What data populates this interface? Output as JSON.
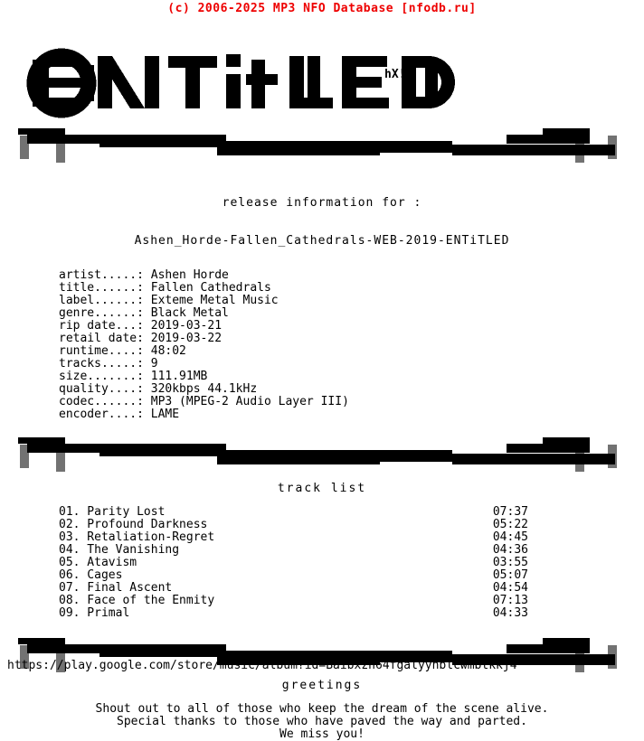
{
  "banner": {
    "copyright": "(c) 2006-2025 MP3 NFO Database [nfodb.ru]",
    "color": "#ee0000"
  },
  "logo": {
    "group_name": "ENTiTLED",
    "artist_signature": "hX!",
    "ascii_art": "  ▄█████▄  ▄██▄  ▄██▄ █████▄ ▄██▄ ███████▄ ▄██▄      ▄████▄  ▄██████▄\n ███▀▀▀███ ████▄ ███▀  ▀██▀  ▀▀███▀▀  ███▀▀     ▀██▀     ███▀▀███ ███▀▀▀███\n ███████▀  ███ ▀████     ██    ███    ███▄▄▄     ██      ███▄▄███ ███   ███\n ███▄▄▄▄▄  ███   ▀███    ██    ███    ███▀▀▀     ██      ███▀▀███ ███▄▄▄███\n  ▀█████▀  ▀██▄   ▀██▀  ▄██▄   ███    ███████▄ ▄████▄▄▄  ███  ███ ▀███████▀",
    "signature_position": "center-right"
  },
  "dividers": {
    "ascii_art": "▄▄▄▄▄                                                                  ▄▄▄▄\n░░░▒▒▓█████▓▓▒░░▄▄▄▄▄▄▄▄▄▄▄▄▄▄▄▒▒░░▄▄▄▄▄▄▄▄▄▄▄▄▄▄▄▄▄▄▄▄▒▒░▄▄▄▄▄▄▄▄▒▓████▓▒░░\n ░▒▓█▓▒░      ▀▀▀▀▀▀▀▀▀▀▀▀▀▀▀▀▀▀▀▀▀▀▀▀▀▀▀▀▀▀▀▀▀▀▀▀▀▀▀▀▀▀▀▀▀▀▀▀▀▀  ░▒▓█▓▒░\n  ░▒▓▒░                                                            ░▒▓▒░\n   ░▒░                                                              ░▒░"
  },
  "release": {
    "heading": "release information for :",
    "dirname": "Ashen_Horde-Fallen_Cathedrals-WEB-2019-ENTiTLED"
  },
  "info": {
    "rows": [
      {
        "label": "artist.....:",
        "value": "Ashen Horde"
      },
      {
        "label": "title......:",
        "value": "Fallen Cathedrals"
      },
      {
        "label": "label......:",
        "value": "Exteme Metal Music"
      },
      {
        "label": "genre......:",
        "value": "Black Metal"
      },
      {
        "label": "rip date...:",
        "value": "2019-03-21"
      },
      {
        "label": "retail date:",
        "value": "2019-03-22"
      },
      {
        "label": "runtime....:",
        "value": "48:02"
      },
      {
        "label": "tracks.....:",
        "value": "9"
      },
      {
        "label": "size.......:",
        "value": "111.91MB"
      },
      {
        "label": "quality....:",
        "value": "320kbps 44.1kHz"
      },
      {
        "label": "codec......:",
        "value": "MP3 (MPEG-2 Audio Layer III)"
      },
      {
        "label": "encoder....:",
        "value": "LAME"
      }
    ]
  },
  "tracklist": {
    "heading": "track list",
    "tracks": [
      {
        "num": "01.",
        "title": "Parity Lost",
        "time": "07:37"
      },
      {
        "num": "02.",
        "title": "Profound Darkness",
        "time": "05:22"
      },
      {
        "num": "03.",
        "title": "Retaliation-Regret",
        "time": "04:45"
      },
      {
        "num": "04.",
        "title": "The Vanishing",
        "time": "04:36"
      },
      {
        "num": "05.",
        "title": "Atavism",
        "time": "03:55"
      },
      {
        "num": "06.",
        "title": "Cages",
        "time": "05:07"
      },
      {
        "num": "07.",
        "title": "Final Ascent",
        "time": "04:54"
      },
      {
        "num": "08.",
        "title": "Face of the Enmity",
        "time": "07:13"
      },
      {
        "num": "09.",
        "title": "Primal",
        "time": "04:33"
      }
    ]
  },
  "greetings": {
    "heading": "greetings",
    "lines": [
      "Shout out to all of those who keep the dream of the scene alive.",
      "Special thanks to those who have paved the way and parted.",
      "We miss you!"
    ]
  },
  "footer": {
    "url": "https://play.google.com/store/music/album?id=Baibxzh64fgalyyhblcwmbtkkj4"
  }
}
